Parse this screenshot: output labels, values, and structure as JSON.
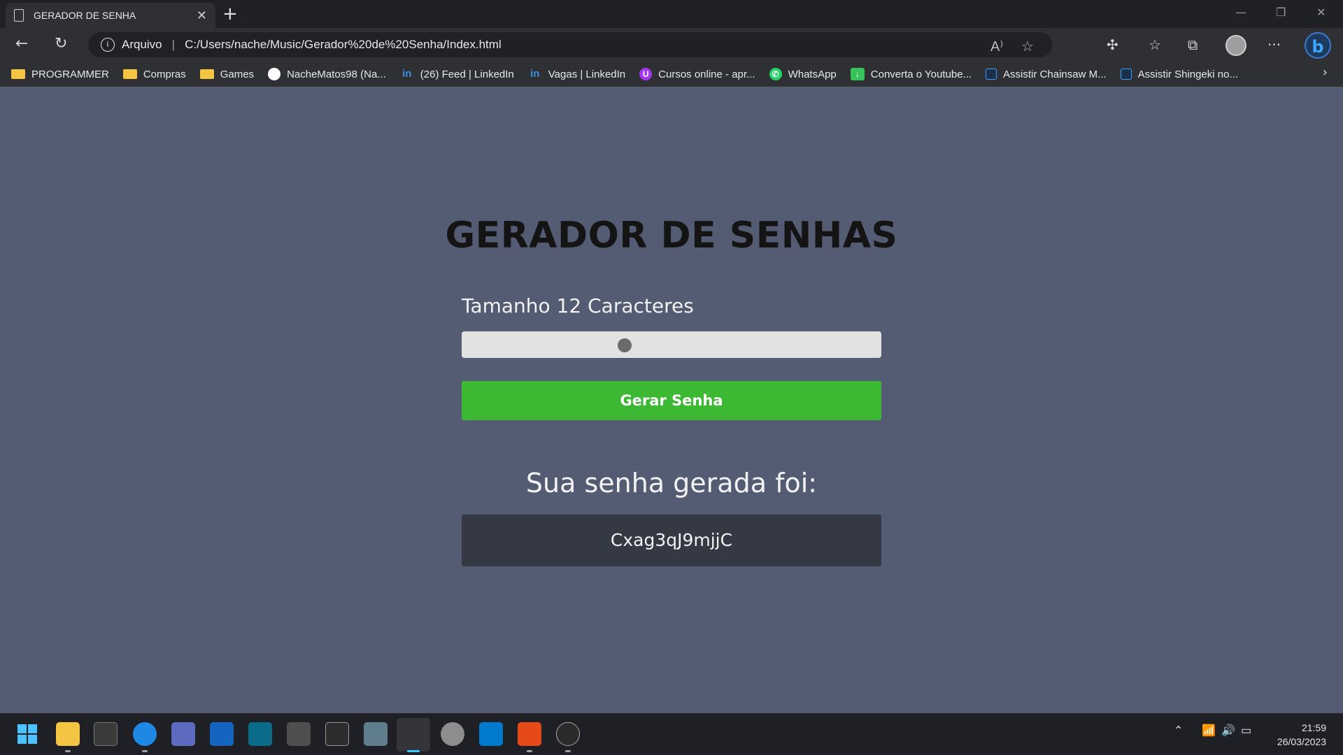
{
  "browser": {
    "tab_title": "GERADOR DE SENHA",
    "tab_close": "✕",
    "new_tab": "+",
    "address_security": "Arquivo",
    "address_url": "C:/Users/nache/Music/Gerador%20de%20Senha/Index.html"
  },
  "bookmarks": [
    {
      "label": "PROGRAMMER",
      "icon": "folder-icon"
    },
    {
      "label": "Compras",
      "icon": "folder-icon"
    },
    {
      "label": "Games",
      "icon": "folder-icon"
    },
    {
      "label": "NacheMatos98 (Na...",
      "icon": "github-icon"
    },
    {
      "label": "(26) Feed | LinkedIn",
      "icon": "linkedin-icon"
    },
    {
      "label": "Vagas | LinkedIn",
      "icon": "linkedin-icon"
    },
    {
      "label": "Cursos online - apr...",
      "icon": "udemy-icon"
    },
    {
      "label": "WhatsApp",
      "icon": "whatsapp-icon"
    },
    {
      "label": "Converta o Youtube...",
      "icon": "download-icon"
    },
    {
      "label": "Assistir Chainsaw M...",
      "icon": "anime-icon"
    },
    {
      "label": "Assistir Shingeki no...",
      "icon": "anime-icon"
    }
  ],
  "page": {
    "heading": "GERADOR DE SENHAS",
    "size_label": "Tamanho 12 Caracteres",
    "slider_value": 12,
    "generate_button": "Gerar Senha",
    "result_label": "Sua senha gerada foi:",
    "password": "Cxag3qJ9mjjC"
  },
  "colors": {
    "page_background": "#535c72",
    "button_green": "#3cb832",
    "result_box": "#353944"
  },
  "taskbar": {
    "time": "21:59",
    "date": "26/03/2023"
  }
}
